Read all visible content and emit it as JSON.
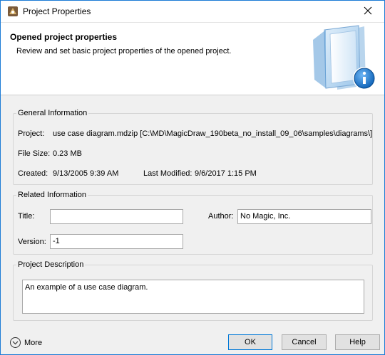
{
  "window": {
    "title": "Project Properties",
    "accent": "#1c7bd6"
  },
  "header": {
    "title": "Opened project properties",
    "subtitle": "Review and set basic project properties of the opened project."
  },
  "general": {
    "legend": "General Information",
    "project_label": "Project:",
    "project_value": "use case diagram.mdzip [C:\\MD\\MagicDraw_190beta_no_install_09_06\\samples\\diagrams\\]",
    "filesize_label": "File Size:",
    "filesize_value": "0.23 MB",
    "created_label": "Created:",
    "created_value": "9/13/2005 9:39 AM",
    "modified_label": "Last Modified:",
    "modified_value": "9/6/2017 1:15 PM"
  },
  "related": {
    "legend": "Related Information",
    "title_label": "Title:",
    "title_value": "",
    "author_label": "Author:",
    "author_value": "No Magic, Inc.",
    "version_label": "Version:",
    "version_value": "-1"
  },
  "description": {
    "legend": "Project Description",
    "value": "An example of a use case diagram."
  },
  "footer": {
    "more_label": "More",
    "ok_label": "OK",
    "cancel_label": "Cancel",
    "help_label": "Help"
  },
  "icons": {
    "app": "magicdraw-app-icon",
    "close": "close-icon",
    "header": "document-info-icon",
    "more": "chevron-down-icon"
  }
}
